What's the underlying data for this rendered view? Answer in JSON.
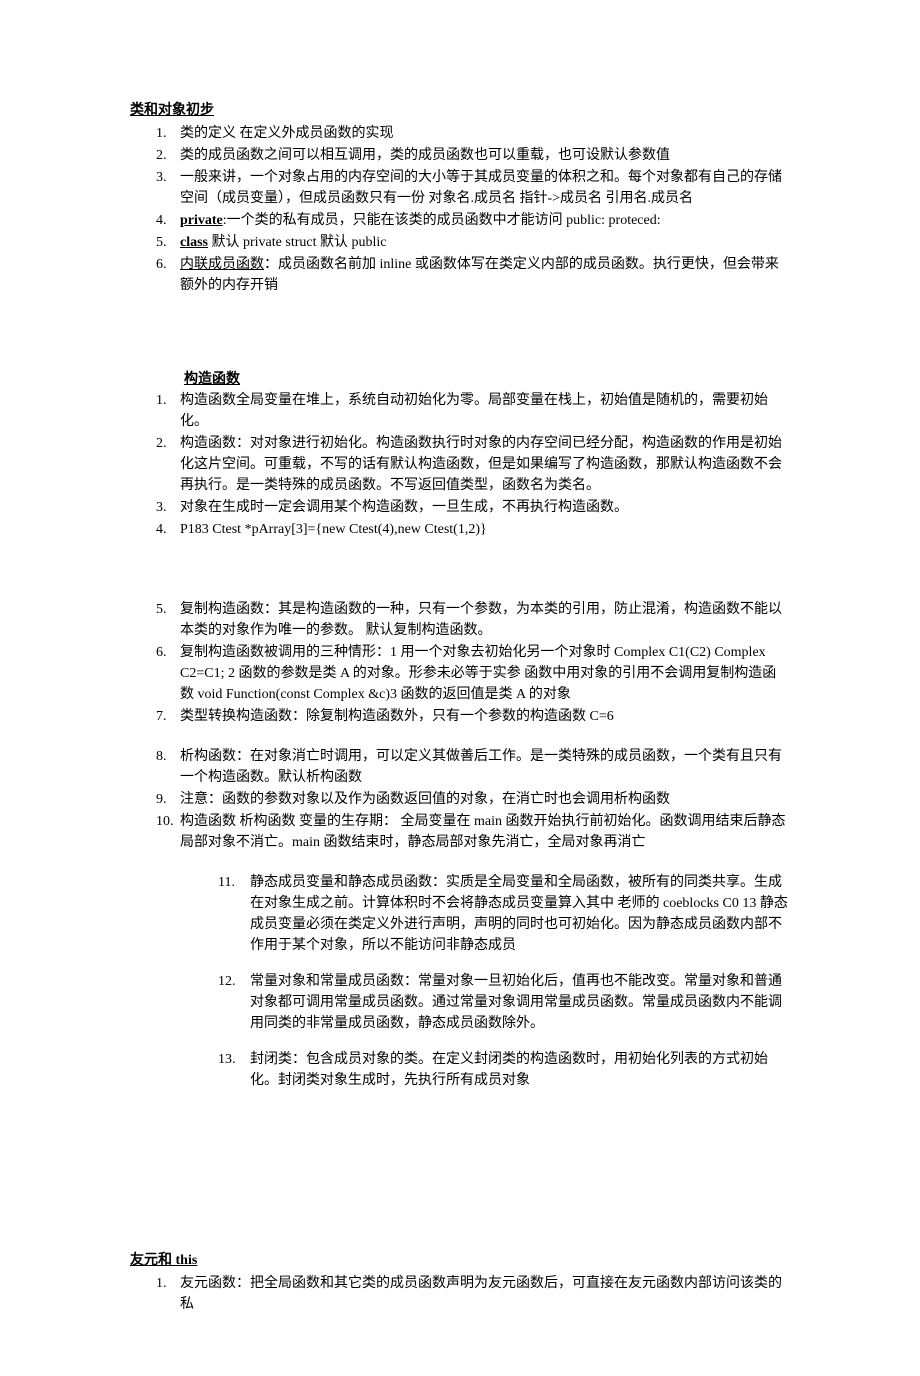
{
  "section1": {
    "title": "类和对象初步",
    "items": [
      {
        "n": "1.",
        "t": "类的定义 在定义外成员函数的实现"
      },
      {
        "n": "2.",
        "t": "类的成员函数之间可以相互调用，类的成员函数也可以重载，也可设默认参数值"
      },
      {
        "n": "3.",
        "t": "一般来讲，一个对象占用的内存空间的大小等于其成员变量的体积之和。每个对象都有自己的存储空间（成员变量），但成员函数只有一份 对象名.成员名 指针->成员名 引用名.成员名"
      },
      {
        "n": "4.",
        "pre": "",
        "ub": "private",
        "post": ":一个类的私有成员，只能在该类的成员函数中才能访问 public: proteced:"
      },
      {
        "n": "5.",
        "pre": "",
        "ub": "class",
        "post": " 默认 private struct 默认 public"
      },
      {
        "n": "6.",
        "pre": "",
        "u": "内联成员函数",
        "post": "：成员函数名前加 inline 或函数体写在类定义内部的成员函数。执行更快，但会带来额外的内存开销"
      }
    ]
  },
  "section2": {
    "title": "构造函数",
    "items1": [
      {
        "n": "1.",
        "t": "构造函数全局变量在堆上，系统自动初始化为零。局部变量在栈上，初始值是随机的，需要初始化。"
      },
      {
        "n": "2.",
        "t": "构造函数：对对象进行初始化。构造函数执行时对象的内存空间已经分配，构造函数的作用是初始化这片空间。可重载，不写的话有默认构造函数，但是如果编写了构造函数，那默认构造函数不会再执行。是一类特殊的成员函数。不写返回值类型，函数名为类名。"
      },
      {
        "n": "3.",
        "t": "对象在生成时一定会调用某个构造函数，一旦生成，不再执行构造函数。"
      },
      {
        "n": "4.",
        "t": "P183 Ctest *pArray[3]={new Ctest(4),new Ctest(1,2)}"
      }
    ],
    "items2": [
      {
        "n": "5.",
        "t": "复制构造函数：其是构造函数的一种，只有一个参数，为本类的引用，防止混淆，构造函数不能以本类的对象作为唯一的参数。 默认复制构造函数。"
      },
      {
        "n": "6.",
        "t": "复制构造函数被调用的三种情形：1 用一个对象去初始化另一个对象时 Complex C1(C2) Complex C2=C1; 2 函数的参数是类 A 的对象。形参未必等于实参 函数中用对象的引用不会调用复制构造函数 void Function(const Complex &c)3 函数的返回值是类 A 的对象"
      },
      {
        "n": "7.",
        "t": "类型转换构造函数：除复制构造函数外，只有一个参数的构造函数 C=6"
      }
    ],
    "items3": [
      {
        "n": "8.",
        "t": "析构函数：在对象消亡时调用，可以定义其做善后工作。是一类特殊的成员函数，一个类有且只有一个构造函数。默认析构函数"
      },
      {
        "n": "9.",
        "t": "注意：函数的参数对象以及作为函数返回值的对象，在消亡时也会调用析构函数"
      },
      {
        "n": "10.",
        "t": "构造函数 析构函数 变量的生存期： 全局变量在 main 函数开始执行前初始化。函数调用结束后静态局部对象不消亡。main 函数结束时，静态局部对象先消亡，全局对象再消亡"
      }
    ],
    "items4": [
      {
        "n": "11.",
        "t": "静态成员变量和静态成员函数：实质是全局变量和全局函数，被所有的同类共享。生成在对象生成之前。计算体积时不会将静态成员变量算入其中 老师的 coeblocks C0 13 静态成员变量必须在类定义外进行声明，声明的同时也可初始化。因为静态成员函数内部不作用于某个对象，所以不能访问非静态成员"
      },
      {
        "n": "12.",
        "t": "常量对象和常量成员函数：常量对象一旦初始化后，值再也不能改变。常量对象和普通对象都可调用常量成员函数。通过常量对象调用常量成员函数。常量成员函数内不能调用同类的非常量成员函数，静态成员函数除外。"
      },
      {
        "n": "13.",
        "t": "封闭类：包含成员对象的类。在定义封闭类的构造函数时，用初始化列表的方式初始化。封闭类对象生成时，先执行所有成员对象"
      }
    ]
  },
  "section3": {
    "title": "友元和 this",
    "items": [
      {
        "n": "1.",
        "t": "友元函数：把全局函数和其它类的成员函数声明为友元函数后，可直接在友元函数内部访问该类的私"
      }
    ]
  }
}
